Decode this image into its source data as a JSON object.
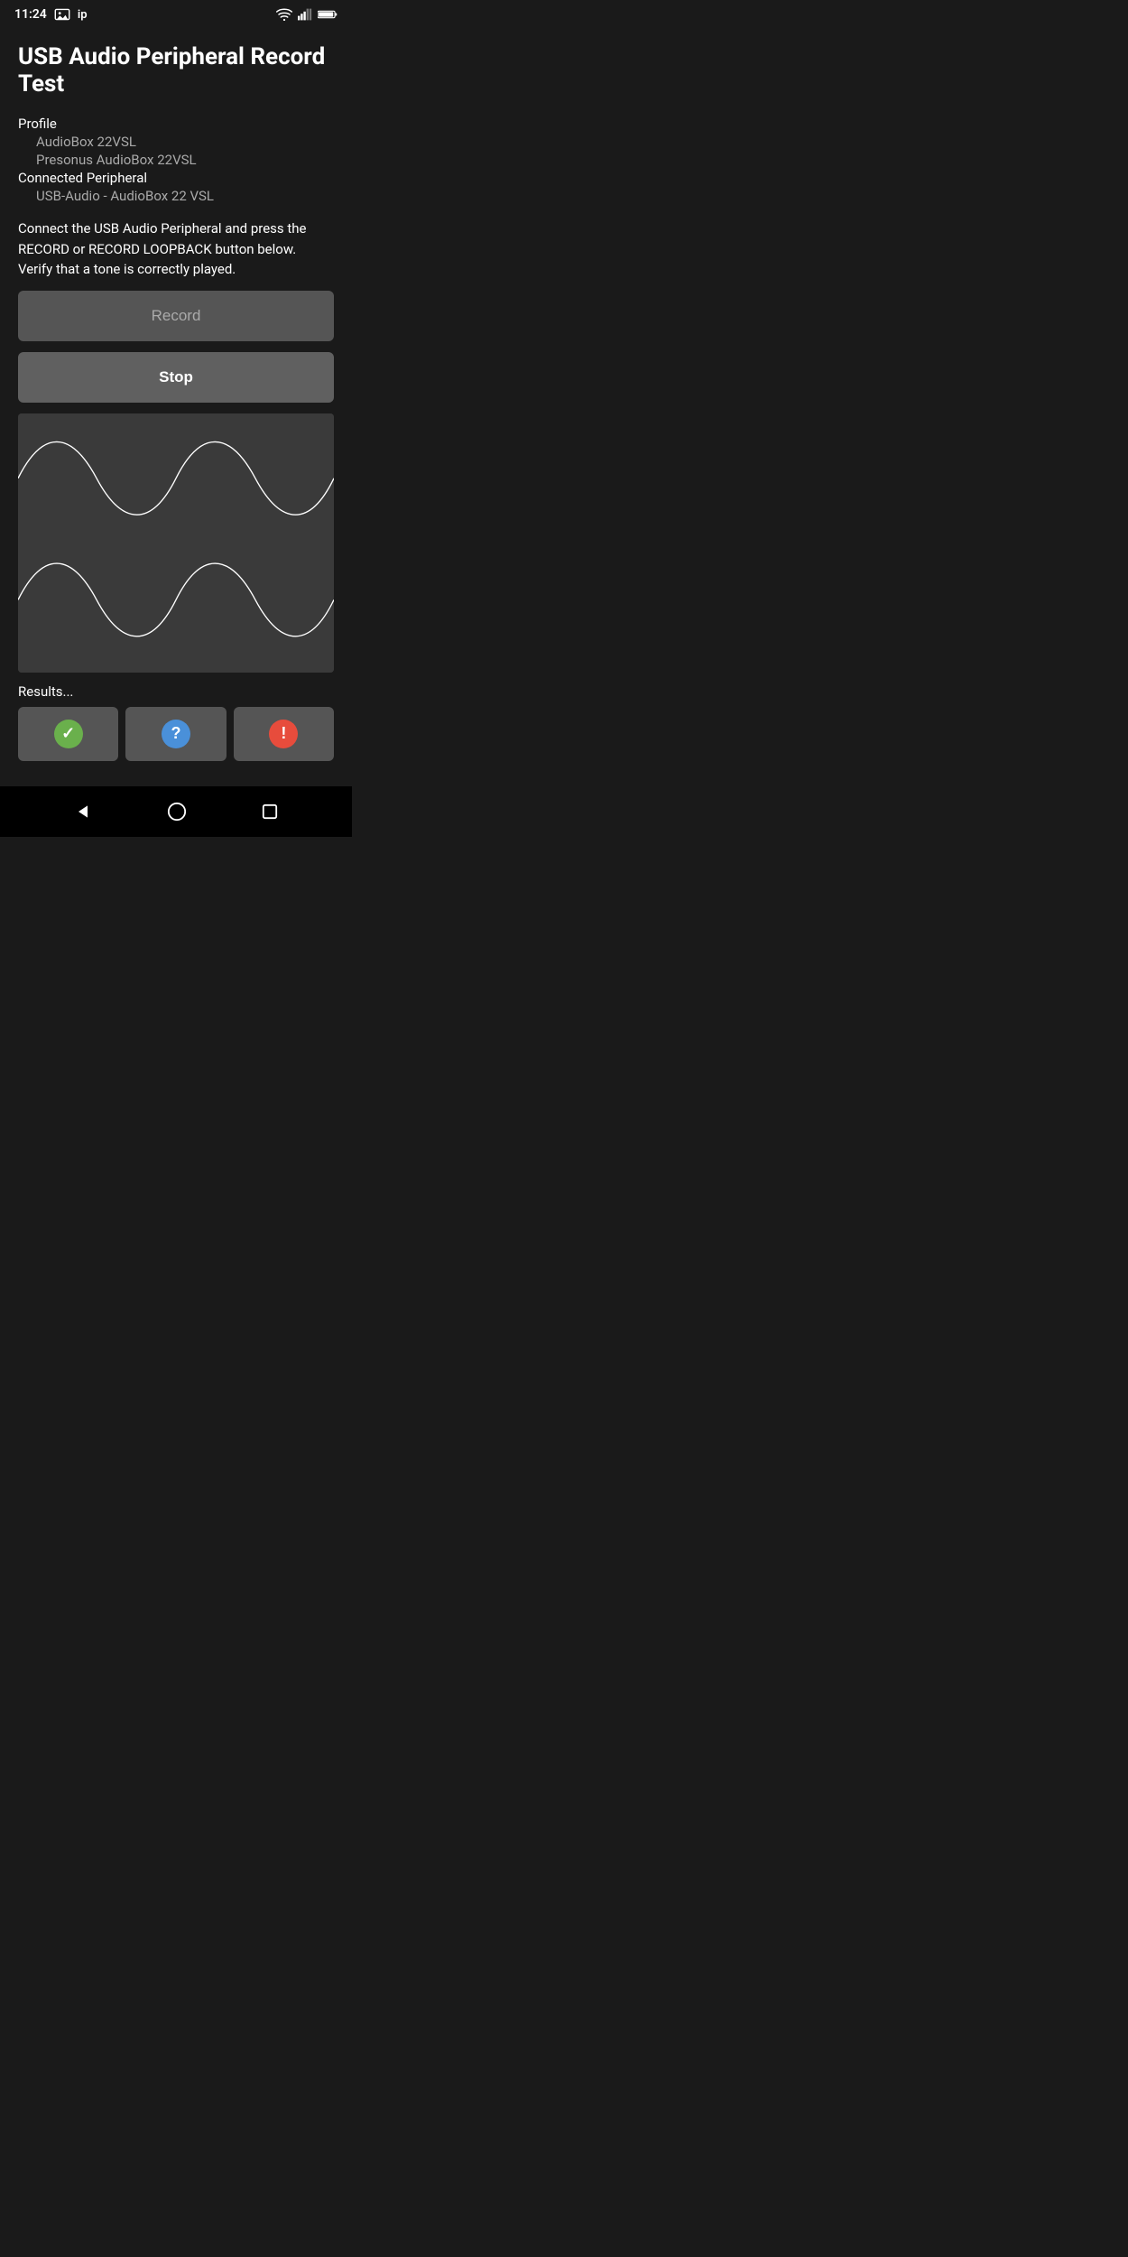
{
  "statusBar": {
    "time": "11:24",
    "icons": [
      "image",
      "ip",
      "wifi",
      "signal",
      "battery"
    ]
  },
  "page": {
    "title": "USB Audio Peripheral Record Test",
    "profile": {
      "label": "Profile",
      "line1": "AudioBox 22VSL",
      "line2": "Presonus AudioBox 22VSL"
    },
    "connectedPeripheral": {
      "label": "Connected Peripheral",
      "value": "USB-Audio - AudioBox 22 VSL"
    },
    "description": "Connect the USB Audio Peripheral and press the RECORD or RECORD LOOPBACK button below. Verify that a tone is correctly played.",
    "recordButton": "Record",
    "stopButton": "Stop",
    "results": {
      "label": "Results...",
      "buttons": [
        {
          "icon": "check",
          "type": "success"
        },
        {
          "icon": "question",
          "type": "info"
        },
        {
          "icon": "exclaim",
          "type": "error"
        }
      ]
    }
  },
  "bottomNav": {
    "back": "◀",
    "home": "⬤",
    "recent": "■"
  }
}
